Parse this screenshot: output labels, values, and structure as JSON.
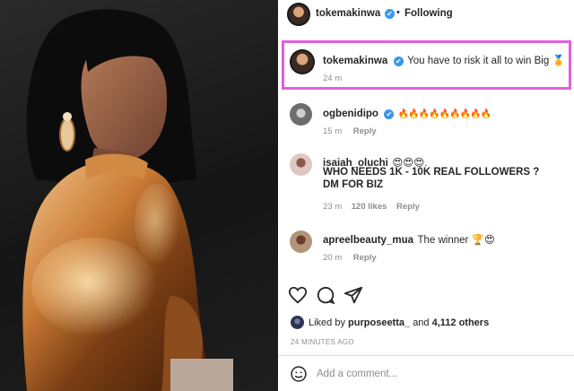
{
  "post": {
    "author": "tokemakinwa",
    "verified": "✔",
    "separator": "•",
    "follow_status": "Following"
  },
  "caption": {
    "username": "tokemakinwa",
    "verified": "✔",
    "text": "You have to risk it all to win Big 🏅",
    "time": "24 m"
  },
  "comments": [
    {
      "username": "ogbenidipo",
      "verified": "✔",
      "text": "🔥🔥🔥🔥🔥🔥🔥🔥🔥",
      "time": "15 m",
      "likes": "",
      "reply": "Reply"
    },
    {
      "username": "isaiah_oluchi",
      "text": "😍😍😍.",
      "text_line2": "WHO NEEDS 1K - 10K REAL FOLLOWERS ?",
      "text_line3": "DM FOR BIZ",
      "time": "23 m",
      "likes": "120 likes",
      "reply": "Reply"
    },
    {
      "username": "apreelbeauty_mua",
      "text": "The winner 🏆😍",
      "time": "20 m",
      "likes": "",
      "reply": "Reply"
    }
  ],
  "actions": {
    "like_icon": "heart-icon",
    "comment_icon": "comment-icon",
    "share_icon": "share-icon"
  },
  "likes": {
    "prefix": "Liked by",
    "user": "purposeetta_",
    "conj": "and",
    "count": "4,112 others"
  },
  "posted_ago": "24 MINUTES AGO",
  "add_comment": {
    "placeholder": "Add a comment..."
  },
  "colors": {
    "highlight": "#e05fe0",
    "verified": "#3897f0",
    "muted": "#8e8e8e"
  }
}
